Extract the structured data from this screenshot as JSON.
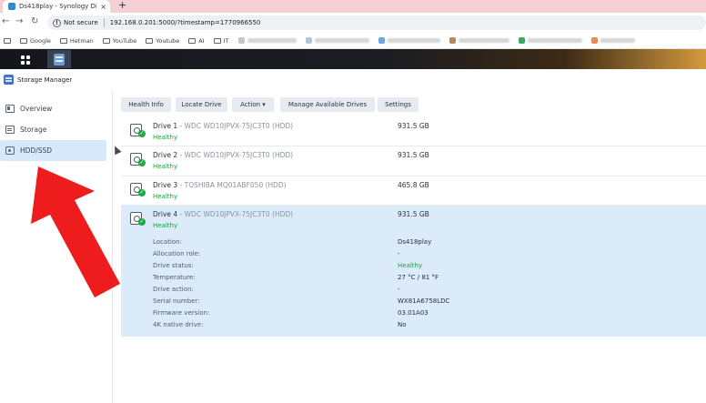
{
  "browser": {
    "tab_title": "Ds418play - Synology DiskStati...",
    "tab_close": "×",
    "new_tab": "+",
    "not_secure": "Not secure",
    "url": "192.168.0.201:5000/?timestamp=1770966550",
    "back": "←",
    "forward": "→",
    "reload": "↻",
    "bookmarks": [
      "Google",
      "Hetman",
      "YouTube",
      "Youtube",
      "AI",
      "IT"
    ]
  },
  "app": {
    "title": "Storage Manager"
  },
  "sidebar": {
    "items": [
      {
        "label": "Overview"
      },
      {
        "label": "Storage"
      },
      {
        "label": "HDD/SSD"
      }
    ]
  },
  "toolbar": {
    "health_info": "Health Info",
    "locate_drive": "Locate Drive",
    "action": "Action ▾",
    "manage_drives": "Manage Available Drives",
    "settings": "Settings"
  },
  "drives": [
    {
      "name": "Drive 1",
      "model": " - WDC WD10JPVX-75JC3T0 (HDD)",
      "status": "Healthy",
      "capacity": "931.5 GB"
    },
    {
      "name": "Drive 2",
      "model": " - WDC WD10JPVX-75JC3T0 (HDD)",
      "status": "Healthy",
      "capacity": "931.5 GB"
    },
    {
      "name": "Drive 3",
      "model": " - TOSHIBA MQ01ABF050 (HDD)",
      "status": "Healthy",
      "capacity": "465.8 GB"
    },
    {
      "name": "Drive 4",
      "model": " - WDC WD10JPVX-75JC3T0 (HDD)",
      "status": "Healthy",
      "capacity": "931.5 GB"
    }
  ],
  "details": {
    "labels": [
      "Location:",
      "Allocation role:",
      "Drive status:",
      "Temperature:",
      "Drive action:",
      "Serial number:",
      "Firmware version:",
      "4K native drive:"
    ],
    "values": [
      "Ds418play",
      "-",
      "Healthy",
      "27 °C / 81 °F",
      "-",
      "WX81A6758LDC",
      "03.01A03",
      "No"
    ]
  },
  "colors": {
    "healthy": "#18a33b",
    "selected_row": "#dcebfa",
    "arrow": "#ee1c1c"
  }
}
